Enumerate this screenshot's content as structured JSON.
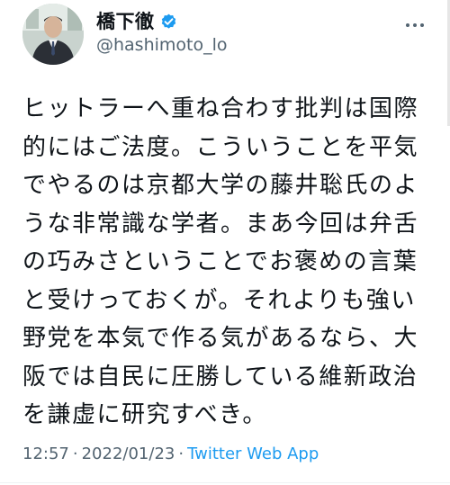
{
  "author": {
    "display_name": "橋下徹",
    "handle": "@hashimoto_lo",
    "verified": true
  },
  "icons": {
    "avatar": "avatar",
    "verified": "verified-badge-icon",
    "more": "more-options-icon"
  },
  "colors": {
    "verified": "#1d9bf0",
    "link": "#1d9bf0",
    "muted": "#536471",
    "text": "#0f1419"
  },
  "tweet": {
    "text": "ヒットラーへ重ね合わす批判は国際\n的にはご法度。こういうことを平気\nでやるのは京都大学の藤井聡氏のよ\nうな非常識な学者。まあ今回は弁舌\nの巧みさということでお褒めの言葉\nと受けっておくが。それよりも強い\n野党を本気で作る気があるなら、大\n阪では自民に圧勝している維新政治\nを謙虚に研究すべき。",
    "time": "12:57",
    "separator": "·",
    "date": "2022/01/23",
    "source": "Twitter Web App"
  }
}
